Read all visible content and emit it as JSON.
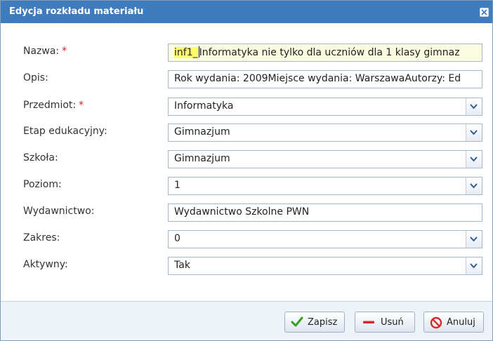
{
  "dialog": {
    "title": "Edycja rozkładu materiału",
    "close_icon": "close-icon"
  },
  "form": {
    "nazwa": {
      "label": "Nazwa:",
      "required_mark": "*",
      "value_highlight": "inf1_",
      "value_rest": "Informatyka nie tylko dla uczniów dla 1 klasy gimnaz"
    },
    "opis": {
      "label": "Opis:",
      "value": "Rok wydania: 2009Miejsce wydania: WarszawaAutorzy: Ed"
    },
    "przedmiot": {
      "label": "Przedmiot:",
      "required_mark": "*",
      "value": "Informatyka"
    },
    "etap": {
      "label": "Etap edukacyjny:",
      "value": "Gimnazjum"
    },
    "szkola": {
      "label": "Szkoła:",
      "value": "Gimnazjum"
    },
    "poziom": {
      "label": "Poziom:",
      "value": "1"
    },
    "wydawnictwo": {
      "label": "Wydawnictwo:",
      "value": "Wydawnictwo Szkolne PWN"
    },
    "zakres": {
      "label": "Zakres:",
      "value": "0"
    },
    "aktywny": {
      "label": "Aktywny:",
      "value": "Tak"
    }
  },
  "buttons": {
    "save": {
      "label": "Zapisz",
      "icon": "check-icon",
      "color": "#3a9d23"
    },
    "delete": {
      "label": "Usuń",
      "icon": "minus-icon",
      "color": "#d42a2a"
    },
    "cancel": {
      "label": "Anuluj",
      "icon": "cancel-icon",
      "color": "#d42a2a"
    }
  },
  "colors": {
    "titlebar": "#3f7cbe",
    "footer": "#eef3f9"
  }
}
